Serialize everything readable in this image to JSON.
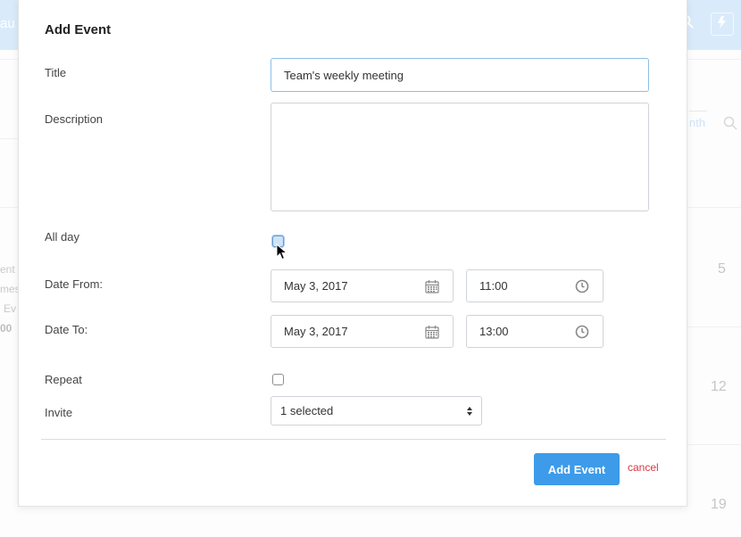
{
  "background": {
    "app_title": "au",
    "view_label": "nth",
    "left_snippets": [
      "ent",
      "mes",
      "Ev",
      "00"
    ],
    "day_numbers": [
      "5",
      "12",
      "19"
    ],
    "bottom_snippets": [
      "-2",
      "-",
      "-",
      "-"
    ]
  },
  "modal": {
    "title": "Add Event",
    "fields": {
      "title_label": "Title",
      "title_value": "Team's weekly meeting",
      "description_label": "Description",
      "description_value": "",
      "all_day_label": "All day",
      "date_from_label": "Date From:",
      "date_from_value": "May 3, 2017",
      "time_from_value": "11:00",
      "date_to_label": "Date To:",
      "date_to_value": "May 3, 2017",
      "time_to_value": "13:00",
      "repeat_label": "Repeat",
      "invite_label": "Invite",
      "invite_value": "1 selected"
    },
    "actions": {
      "submit_label": "Add Event",
      "cancel_label": "cancel"
    }
  },
  "colors": {
    "accent": "#3d9be9",
    "cancel": "#d9363e",
    "topbar": "#d9ebfa"
  },
  "icons": {
    "calendar": "calendar-icon",
    "clock": "clock-icon",
    "select_arrows": "select-arrows-icon",
    "cursor": "mouse-cursor-icon"
  }
}
